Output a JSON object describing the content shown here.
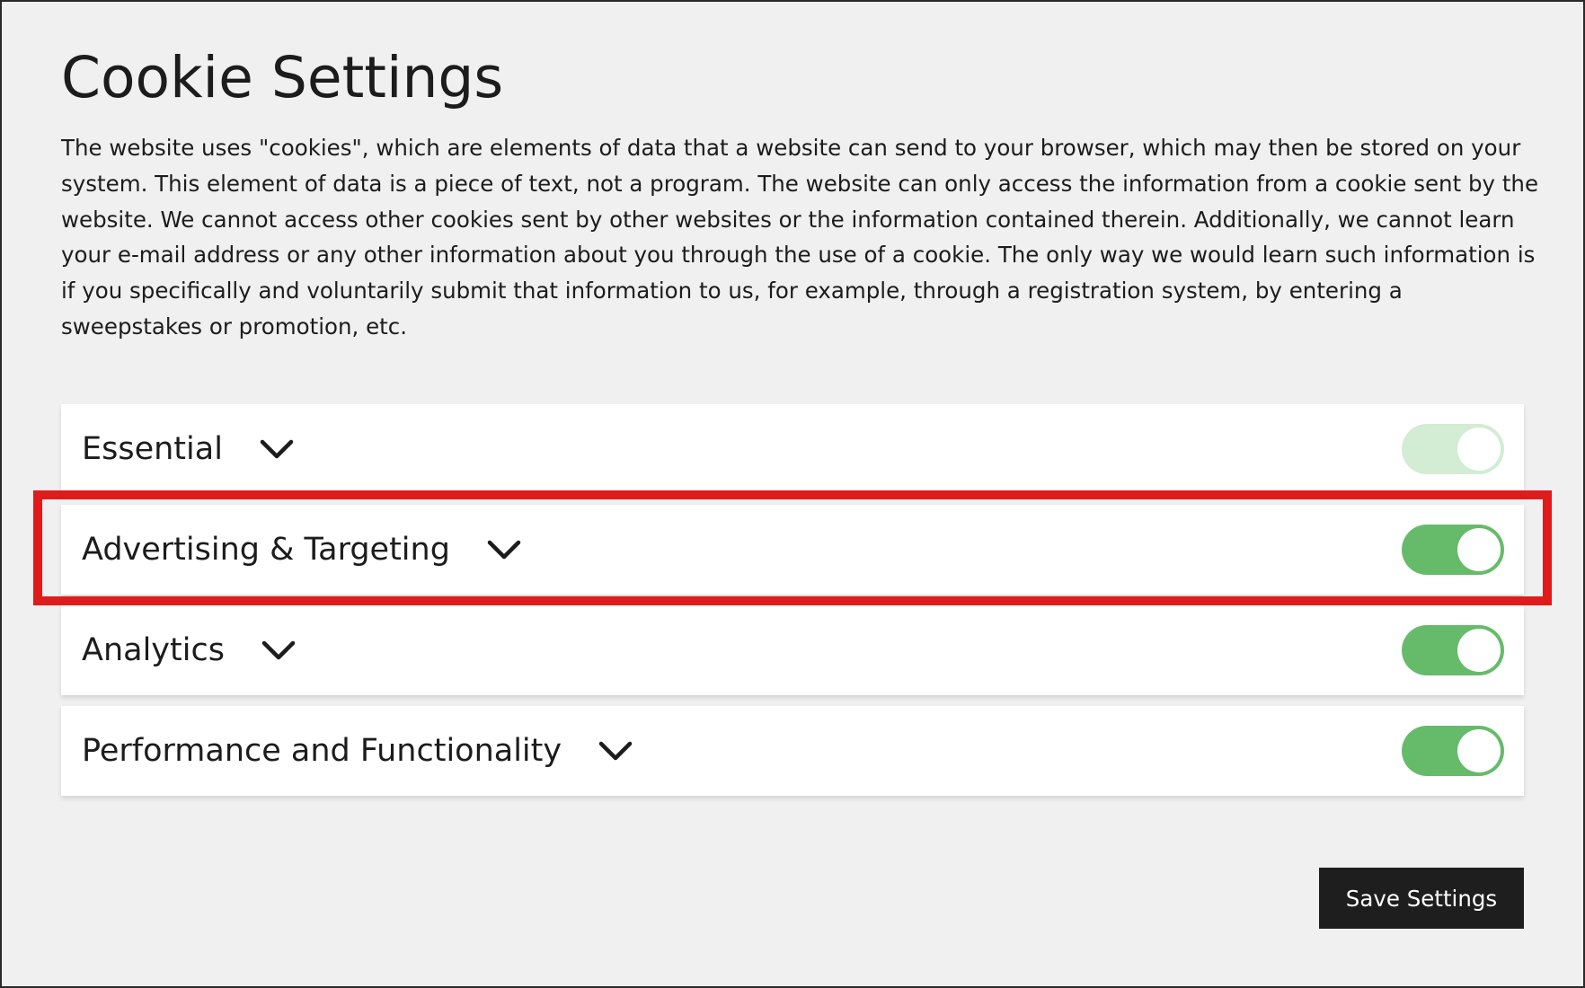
{
  "dialog": {
    "title": "Cookie Settings",
    "description": "The website uses \"cookies\", which are elements of data that a website can send to your browser, which may then be stored on your system. This element of data is a piece of text, not a program. The website can only access the information from a cookie sent by the website. We cannot access other cookies sent by other websites or the information contained therein. Additionally, we cannot learn your e-mail address or any other information about you through the use of a cookie. The only way we would learn such information is if you specifically and voluntarily submit that information to us, for example, through a registration system, by entering a sweepstakes or promotion, etc."
  },
  "categories": [
    {
      "label": "Essential",
      "enabled": true,
      "locked": true,
      "icon": "chevron-down-icon"
    },
    {
      "label": "Advertising & Targeting",
      "enabled": true,
      "locked": false,
      "icon": "chevron-down-icon",
      "highlighted": true
    },
    {
      "label": "Analytics",
      "enabled": true,
      "locked": false,
      "icon": "chevron-down-icon"
    },
    {
      "label": "Performance and Functionality",
      "enabled": true,
      "locked": false,
      "icon": "chevron-down-icon"
    }
  ],
  "actions": {
    "save_label": "Save Settings"
  },
  "colors": {
    "background": "#f0f0f0",
    "toggle_on": "#66bb6a",
    "toggle_disabled": "#d3ecd4",
    "highlight": "#e01b1b",
    "button": "#1e1e1e"
  }
}
